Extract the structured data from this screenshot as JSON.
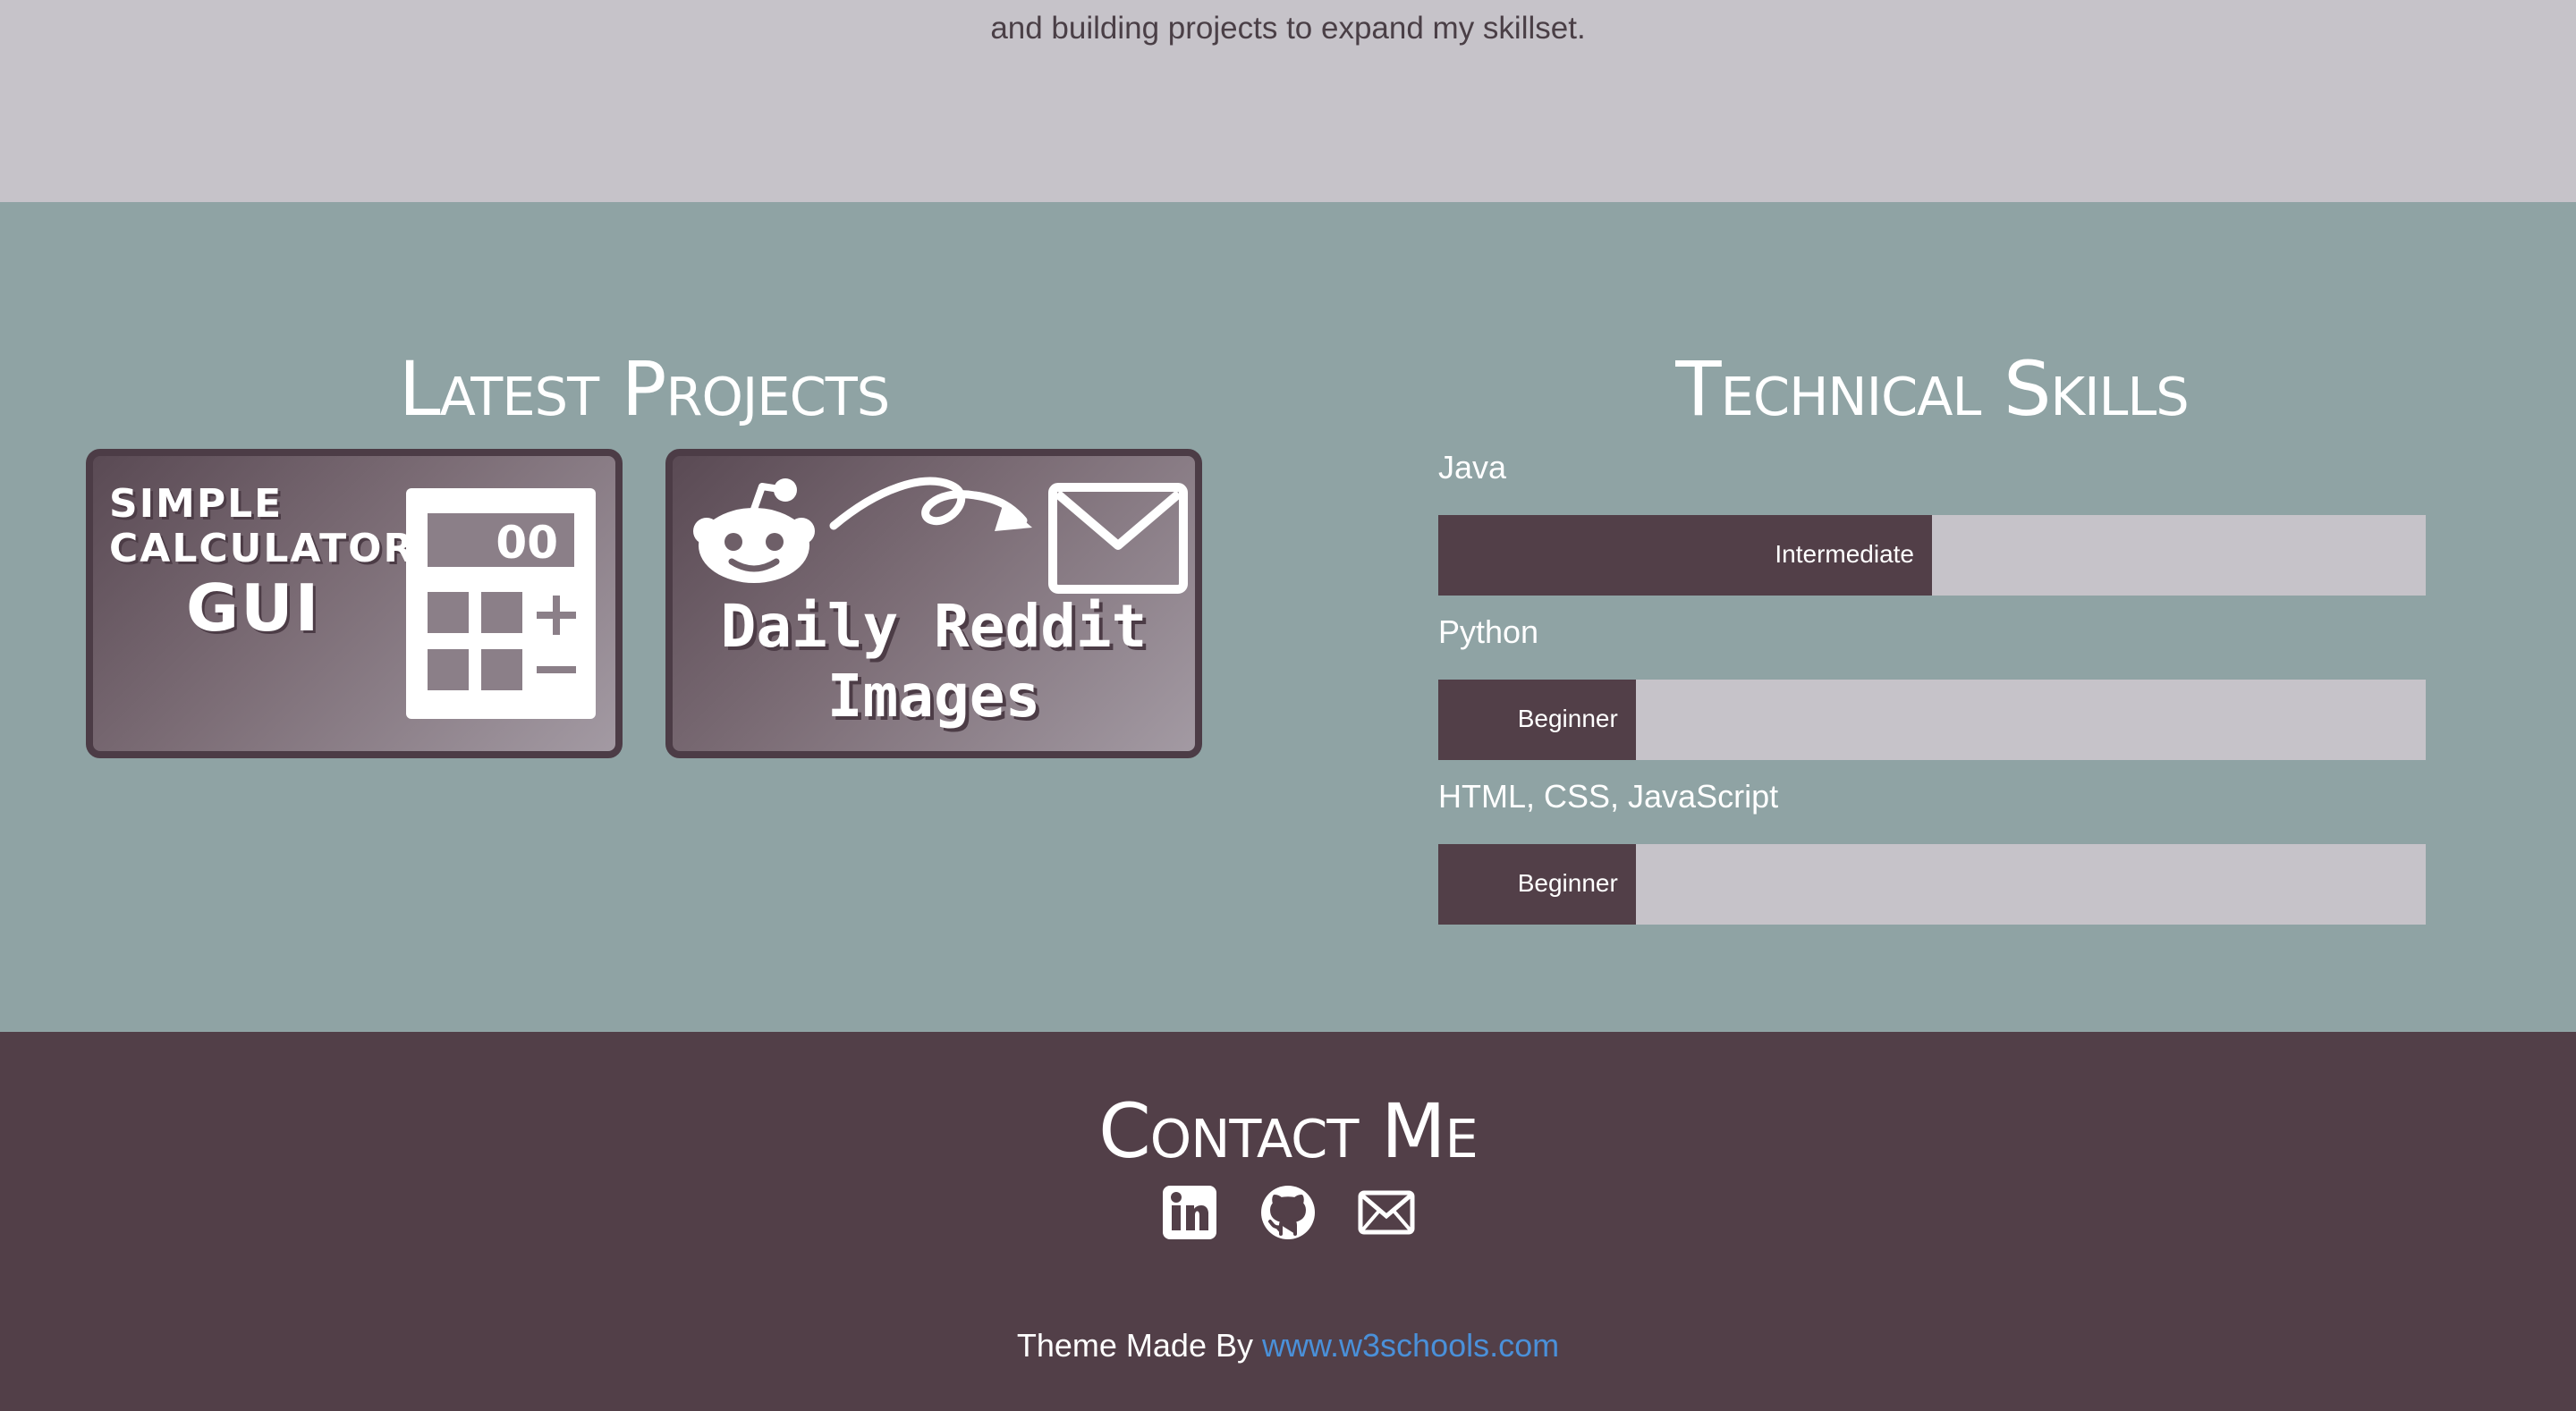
{
  "about": {
    "text": "and building projects to expand my skillset."
  },
  "projects": {
    "title": "Latest Projects",
    "cards": [
      {
        "lines": [
          "SIMPLE",
          "CALCULATOR",
          "GUI"
        ],
        "display": "00"
      },
      {
        "lines": [
          "Daily Reddit",
          "Images"
        ]
      }
    ]
  },
  "skills": {
    "title": "Technical Skills",
    "items": [
      {
        "label": "Java",
        "level": "Intermediate",
        "fill": 0.5
      },
      {
        "label": "Python",
        "level": "Beginner",
        "fill": 0.2
      },
      {
        "label": "HTML, CSS, JavaScript",
        "level": "Beginner",
        "fill": 0.2
      }
    ]
  },
  "contact": {
    "title": "Contact Me",
    "icons": [
      "linkedin-icon",
      "github-icon",
      "mail-icon"
    ],
    "credit_prefix": "Theme Made By",
    "credit_link": "www.w3schools.com"
  },
  "colors": {
    "about_bg": "#c6c3c9",
    "main_bg": "#8fa3a4",
    "footer_bg": "#523f48",
    "bar_fill": "#523f48",
    "bar_track": "#c6c3c9",
    "link": "#4a90d9"
  }
}
